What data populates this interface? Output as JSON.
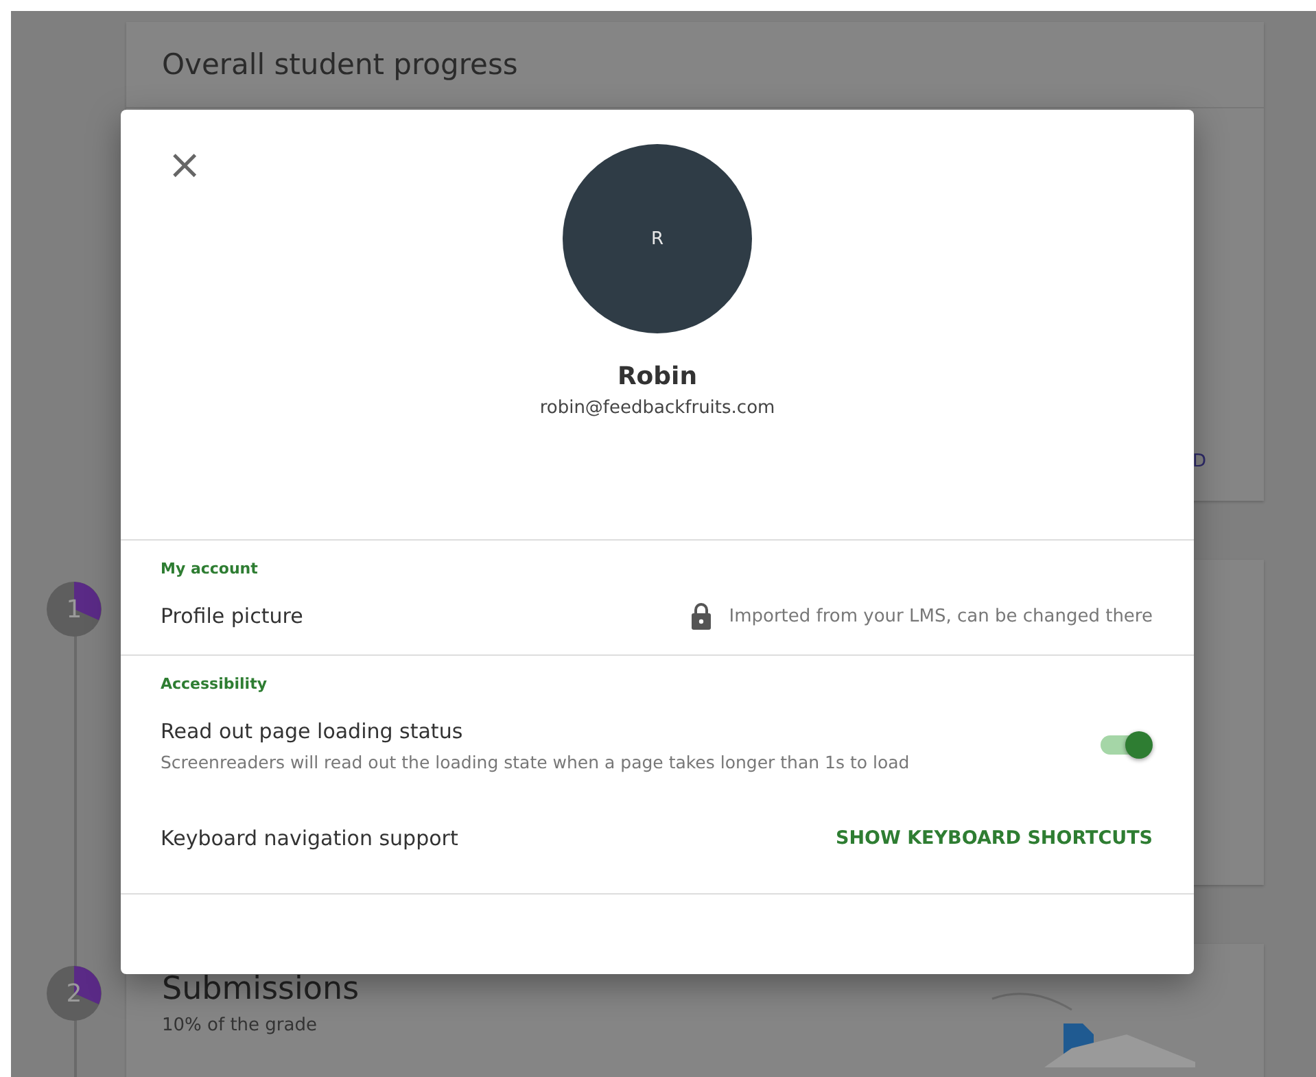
{
  "background": {
    "progress_card": {
      "title": "Overall student progress",
      "link_fragment": "D"
    },
    "steps": [
      {
        "number": "1"
      },
      {
        "number": "2"
      }
    ],
    "submissions_card": {
      "title": "Submissions",
      "subtitle": "10% of the grade"
    }
  },
  "dialog": {
    "close": "×",
    "avatar_initial": "R",
    "name": "Robin",
    "email": "robin@feedbackfruits.com",
    "sections": [
      {
        "heading": "My account",
        "rows": [
          {
            "kind": "info",
            "label": "Profile picture",
            "note": "Imported from your LMS, can be changed there"
          }
        ]
      },
      {
        "heading": "Accessibility",
        "rows": [
          {
            "kind": "toggle",
            "label": "Read out page loading status",
            "description": "Screenreaders will read out the loading state when a page takes longer than 1s to load",
            "on": true
          },
          {
            "kind": "action",
            "label": "Keyboard navigation support",
            "action": "SHOW KEYBOARD SHORTCUTS"
          }
        ]
      }
    ]
  }
}
